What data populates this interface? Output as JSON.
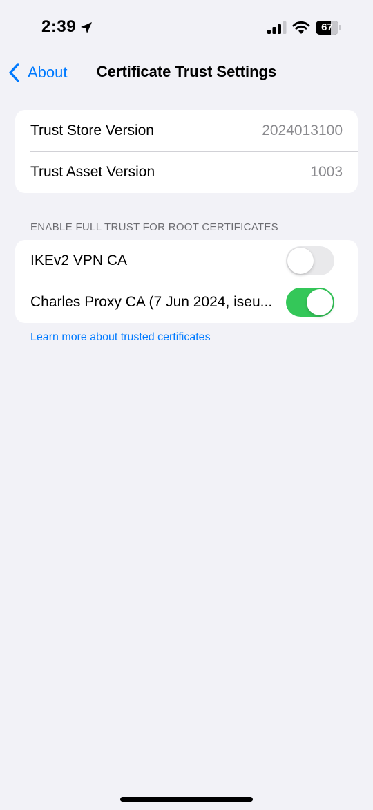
{
  "status_bar": {
    "time": "2:39",
    "battery_percent": "67",
    "battery_level": 0.67,
    "icons": [
      "location-arrow-icon",
      "cellular-signal-icon",
      "wifi-icon",
      "battery-icon"
    ]
  },
  "nav": {
    "back_label": "About",
    "title": "Certificate Trust Settings",
    "back_icon": "chevron-left-icon"
  },
  "versions": [
    {
      "label": "Trust Store Version",
      "value": "2024013100"
    },
    {
      "label": "Trust Asset Version",
      "value": "1003"
    }
  ],
  "trust_section": {
    "header": "ENABLE FULL TRUST FOR ROOT CERTIFICATES",
    "certificates": [
      {
        "label": "IKEv2 VPN CA",
        "enabled": false
      },
      {
        "label": "Charles Proxy CA (7 Jun 2024, iseu...",
        "enabled": true
      }
    ],
    "learn_more": "Learn more about trusted certificates"
  },
  "colors": {
    "accent": "#007aff",
    "toggle_on": "#34c759",
    "toggle_off": "#e9e9eb",
    "background": "#f2f2f7"
  }
}
